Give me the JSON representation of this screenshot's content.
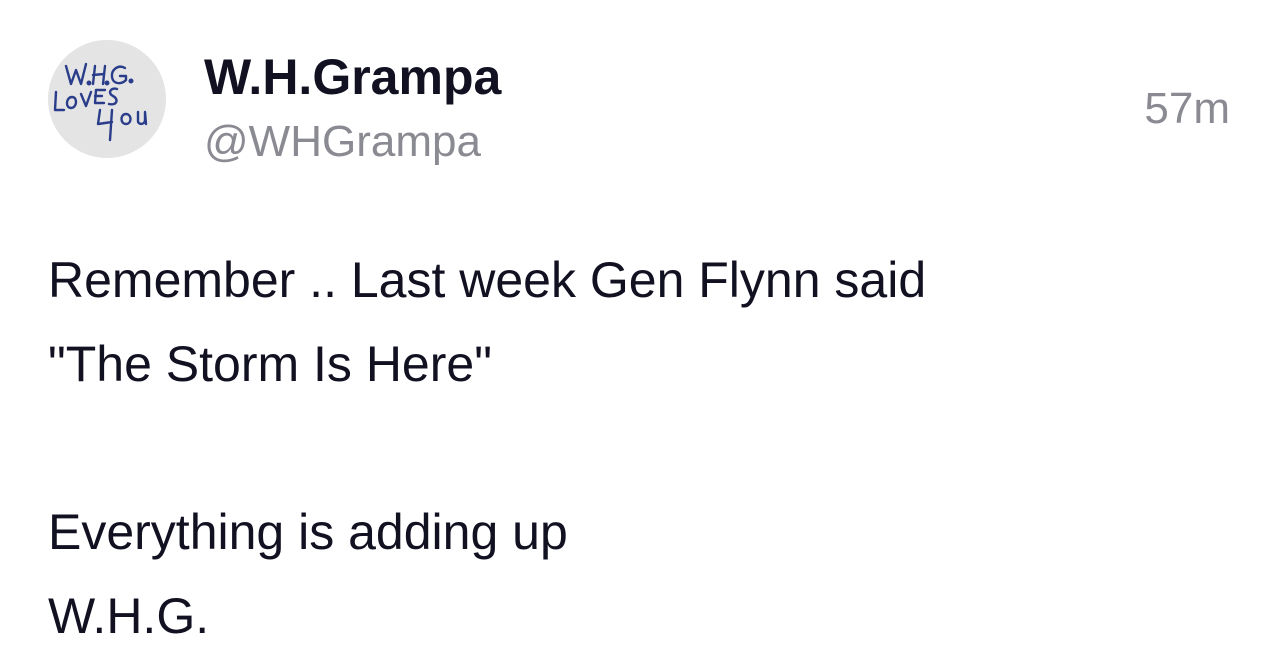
{
  "post": {
    "avatar_icon": "handwritten-signature-avatar",
    "avatar_text": [
      "W.H.G.",
      "LOVES",
      "You"
    ],
    "display_name": "W.H.Grampa",
    "handle": "@WHGrampa",
    "timestamp": "57m",
    "body_lines": [
      "Remember .. Last week Gen Flynn said",
      "\"The Storm Is Here\"",
      "",
      "Everything is adding up",
      "W.H.G."
    ]
  }
}
